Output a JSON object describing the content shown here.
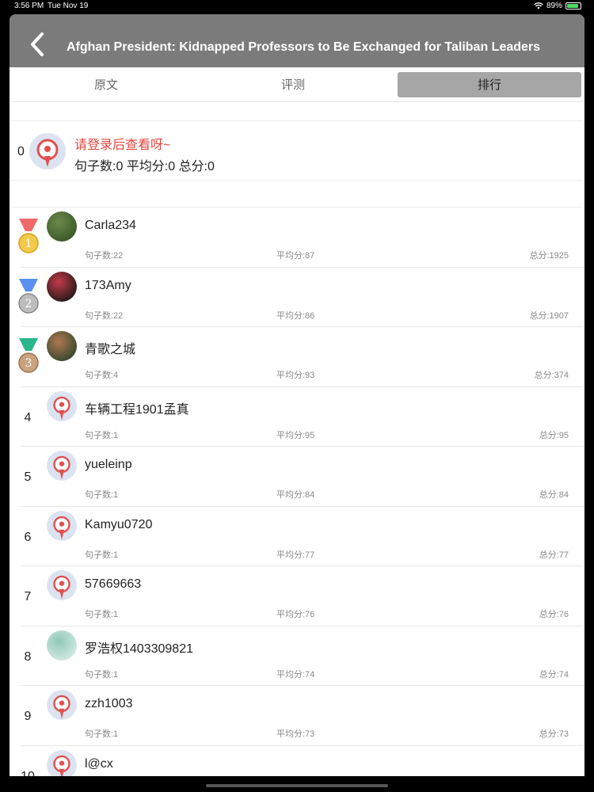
{
  "status": {
    "time": "3:56 PM",
    "date": "Tue Nov 19",
    "battery": "89%",
    "battery_level": 0.89
  },
  "nav": {
    "title": "Afghan President: Kidnapped Professors to Be Exchanged for Taliban Leaders",
    "back_icon": "chevron-left-icon"
  },
  "tabs": [
    {
      "label": "原文",
      "active": false
    },
    {
      "label": "评测",
      "active": false
    },
    {
      "label": "排行",
      "active": true
    }
  ],
  "me": {
    "rank": "0",
    "login_prompt": "请登录后查看呀~",
    "stats": "句子数:0 平均分:0 总分:0"
  },
  "colors": {
    "gold": "#f2c94c",
    "silver": "#bdbdbd",
    "bronze": "#c9a27e",
    "ribbon_red": "#f06a6a",
    "ribbon_blue": "#5b8ff0",
    "ribbon_green": "#2bb58d",
    "accent_red": "#e2473f"
  },
  "ranking": [
    {
      "rank": "1",
      "medal": "gold",
      "name": "Carla234",
      "sentences": "句子数:22",
      "avg": "平均分:87",
      "total": "总分:1925",
      "avatar": "photo-green"
    },
    {
      "rank": "2",
      "medal": "silver",
      "name": "173Amy",
      "sentences": "句子数:22",
      "avg": "平均分:86",
      "total": "总分:1907",
      "avatar": "photo-red"
    },
    {
      "rank": "3",
      "medal": "bronze",
      "name": "青歌之城",
      "sentences": "句子数:4",
      "avg": "平均分:93",
      "total": "总分:374",
      "avatar": "photo-brown"
    },
    {
      "rank": "4",
      "medal": "",
      "name": "车辆工程1901孟真",
      "sentences": "句子数:1",
      "avg": "平均分:95",
      "total": "总分:95",
      "avatar": "default"
    },
    {
      "rank": "5",
      "medal": "",
      "name": "yueleinp",
      "sentences": "句子数:1",
      "avg": "平均分:84",
      "total": "总分:84",
      "avatar": "default"
    },
    {
      "rank": "6",
      "medal": "",
      "name": "Kamyu0720",
      "sentences": "句子数:1",
      "avg": "平均分:77",
      "total": "总分:77",
      "avatar": "default"
    },
    {
      "rank": "7",
      "medal": "",
      "name": "57669663",
      "sentences": "句子数:1",
      "avg": "平均分:76",
      "total": "总分:76",
      "avatar": "default"
    },
    {
      "rank": "8",
      "medal": "",
      "name": "罗浩权1403309821",
      "sentences": "句子数:1",
      "avg": "平均分:74",
      "total": "总分:74",
      "avatar": "photo-teal"
    },
    {
      "rank": "9",
      "medal": "",
      "name": "zzh1003",
      "sentences": "句子数:1",
      "avg": "平均分:73",
      "total": "总分:73",
      "avatar": "default"
    },
    {
      "rank": "10",
      "medal": "",
      "name": "l@cx",
      "sentences": "",
      "avg": "",
      "total": "",
      "avatar": "default"
    }
  ]
}
